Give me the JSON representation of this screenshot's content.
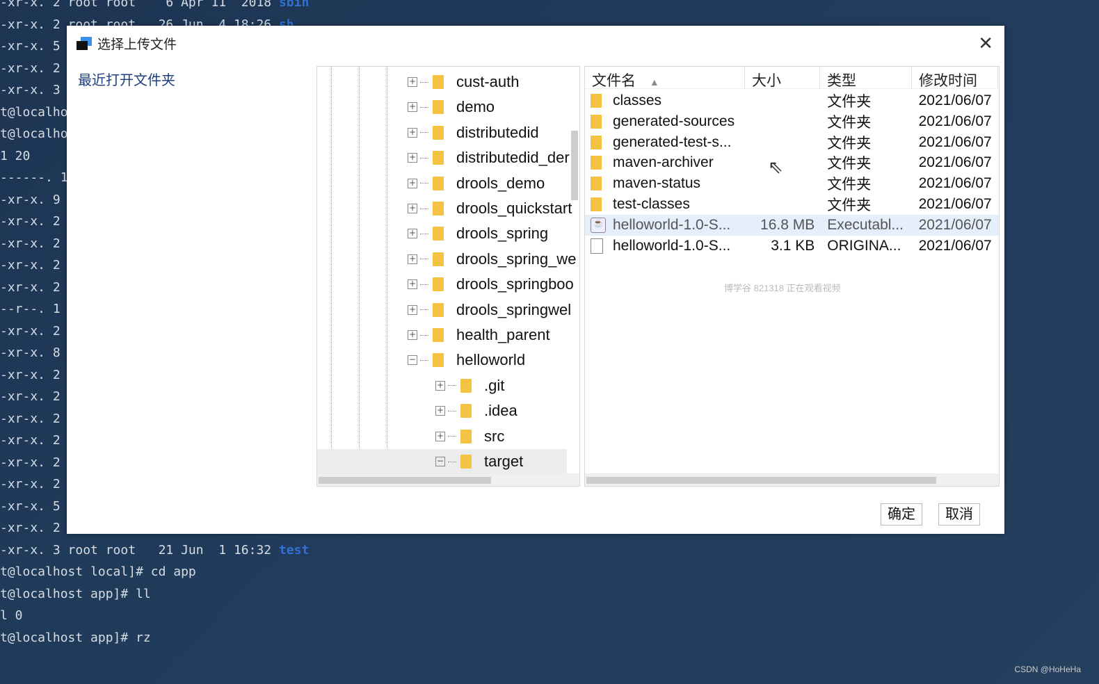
{
  "terminal": {
    "lines": [
      {
        "t": "-xr-x. 2 root root    6 Apr 11  2018 ",
        "hl": "sbin"
      },
      {
        "t": "-xr-x. 2 root root   26 Jun  4 18:26 ",
        "hl": "sh"
      },
      {
        "t": "-xr-x. 5"
      },
      {
        "t": "-xr-x. 2"
      },
      {
        "t": "-xr-x. 3"
      },
      {
        "t": "t@localho"
      },
      {
        "t": "t@localho"
      },
      {
        "t": "1 20"
      },
      {
        "t": "------. 1"
      },
      {
        "t": "-xr-x. 9"
      },
      {
        "t": "-xr-x. 2"
      },
      {
        "t": "-xr-x. 2"
      },
      {
        "t": "-xr-x. 2"
      },
      {
        "t": "-xr-x. 2"
      },
      {
        "t": "--r--. 1"
      },
      {
        "t": "-xr-x. 2"
      },
      {
        "t": "-xr-x. 8"
      },
      {
        "t": "-xr-x. 2"
      },
      {
        "t": "-xr-x. 2"
      },
      {
        "t": "-xr-x. 2"
      },
      {
        "t": "-xr-x. 2"
      },
      {
        "t": "-xr-x. 2"
      },
      {
        "t": "-xr-x. 2"
      },
      {
        "t": "-xr-x. 5"
      },
      {
        "t": "-xr-x. 2"
      },
      {
        "t": "-xr-x. 3 root root   21 Jun  1 16:32 ",
        "hl": "test"
      },
      {
        "t": "t@localhost local]# cd app"
      },
      {
        "t": "t@localhost app]# ll"
      },
      {
        "t": "l 0"
      },
      {
        "t": "t@localhost app]# rz"
      }
    ]
  },
  "dialog": {
    "title": "选择上传文件",
    "recent_label": "最近打开文件夹",
    "tree": [
      {
        "label": "cust-auth",
        "level": 0,
        "expanded": false
      },
      {
        "label": "demo",
        "level": 0,
        "expanded": false
      },
      {
        "label": "distributedid",
        "level": 0,
        "expanded": false
      },
      {
        "label": "distributedid_der",
        "level": 0,
        "expanded": false
      },
      {
        "label": "drools_demo",
        "level": 0,
        "expanded": false
      },
      {
        "label": "drools_quickstart",
        "level": 0,
        "expanded": false
      },
      {
        "label": "drools_spring",
        "level": 0,
        "expanded": false
      },
      {
        "label": "drools_spring_we",
        "level": 0,
        "expanded": false
      },
      {
        "label": "drools_springboo",
        "level": 0,
        "expanded": false
      },
      {
        "label": "drools_springwel",
        "level": 0,
        "expanded": false
      },
      {
        "label": "health_parent",
        "level": 0,
        "expanded": false
      },
      {
        "label": "helloworld",
        "level": 0,
        "expanded": true
      },
      {
        "label": ".git",
        "level": 1,
        "expanded": false
      },
      {
        "label": ".idea",
        "level": 1,
        "expanded": false
      },
      {
        "label": "src",
        "level": 1,
        "expanded": false
      },
      {
        "label": "target",
        "level": 1,
        "expanded": true,
        "selected": true
      }
    ],
    "columns": [
      "文件名",
      "大小",
      "类型",
      "修改时间"
    ],
    "files": [
      {
        "name": "classes",
        "size": "",
        "type": "文件夹",
        "date": "2021/06/07",
        "icon": "folder-icon"
      },
      {
        "name": "generated-sources",
        "size": "",
        "type": "文件夹",
        "date": "2021/06/07",
        "icon": "folder-icon"
      },
      {
        "name": "generated-test-s...",
        "size": "",
        "type": "文件夹",
        "date": "2021/06/07",
        "icon": "folder-icon"
      },
      {
        "name": "maven-archiver",
        "size": "",
        "type": "文件夹",
        "date": "2021/06/07",
        "icon": "folder-icon"
      },
      {
        "name": "maven-status",
        "size": "",
        "type": "文件夹",
        "date": "2021/06/07",
        "icon": "folder-icon"
      },
      {
        "name": "test-classes",
        "size": "",
        "type": "文件夹",
        "date": "2021/06/07",
        "icon": "folder-icon"
      },
      {
        "name": "helloworld-1.0-S...",
        "size": "16.8 MB",
        "type": "Executabl...",
        "date": "2021/06/07",
        "icon": "jar-icon",
        "highlight": true
      },
      {
        "name": "helloworld-1.0-S...",
        "size": "3.1 KB",
        "type": "ORIGINA...",
        "date": "2021/06/07",
        "icon": "file-icon"
      }
    ],
    "watermark": "博学谷 821318 正在观看视频",
    "ok": "确定",
    "cancel": "取消"
  },
  "credit": "CSDN @HoHeHa"
}
